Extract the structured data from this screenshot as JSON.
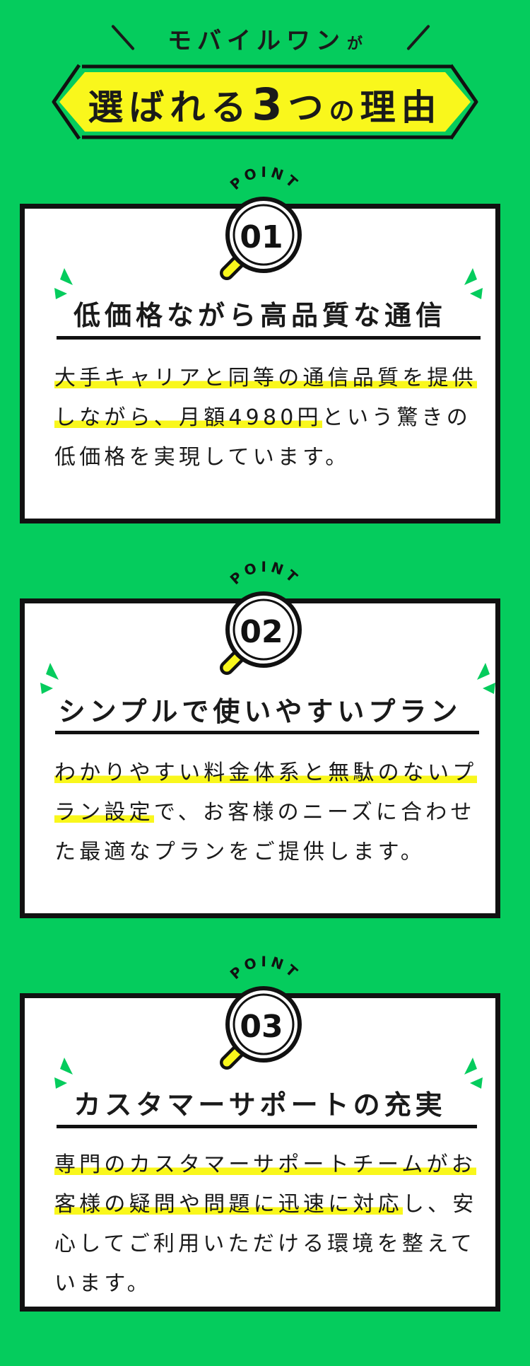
{
  "header": {
    "subtitle": "モバイルワン",
    "subtitle_suffix": "が",
    "title_part1": "選ばれる",
    "title_number": "3",
    "title_part2": "つ",
    "title_part3": "の",
    "title_part4": "理由"
  },
  "point_label": "POINT",
  "colors": {
    "background": "#05cc5d",
    "highlight": "#f9f71c",
    "accent_green": "#05cc5d",
    "ink": "#111111"
  },
  "points": [
    {
      "number": "01",
      "title": "低価格ながら高品質な通信",
      "body_highlight": "大手キャリアと同等の通信品質を提供しながら、月額4980円",
      "body_rest": "という驚きの低価格を実現しています。"
    },
    {
      "number": "02",
      "title": "シンプルで使いやすいプラン",
      "body_highlight": "わかりやすい料金体系と無駄のないプラン設定",
      "body_rest": "で、お客様のニーズに合わせた最適なプランをご提供します。"
    },
    {
      "number": "03",
      "title": "カスタマーサポートの充実",
      "body_highlight": "専門のカスタマーサポートチームがお客様の疑問や問題に迅速に対応",
      "body_rest": "し、安心してご利用いただける環境を整えています。"
    }
  ]
}
